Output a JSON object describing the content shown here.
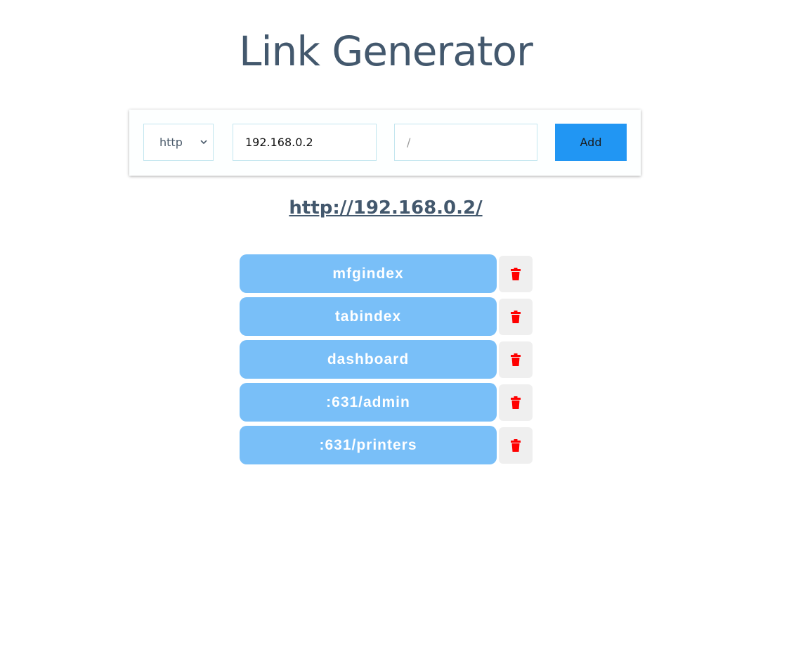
{
  "page": {
    "title": "Link Generator"
  },
  "form": {
    "protocol_selected": "http",
    "protocol_options": [
      "http"
    ],
    "host_value": "192.168.0.2",
    "path_placeholder": "/",
    "add_label": "Add"
  },
  "result": {
    "url": "http://192.168.0.2/"
  },
  "links": [
    {
      "label": "mfgindex"
    },
    {
      "label": "tabindex"
    },
    {
      "label": "dashboard"
    },
    {
      "label": ":631/admin"
    },
    {
      "label": ":631/printers"
    }
  ],
  "icons": {
    "select_caret": "chevron-down-icon",
    "delete": "trash-icon"
  },
  "colors": {
    "title": "#43586d",
    "add_button": "#2196f3",
    "link_button": "#79bff8",
    "delete_icon": "#ff0000",
    "delete_button_bg": "#efefef",
    "input_border": "#c3e6ef"
  }
}
